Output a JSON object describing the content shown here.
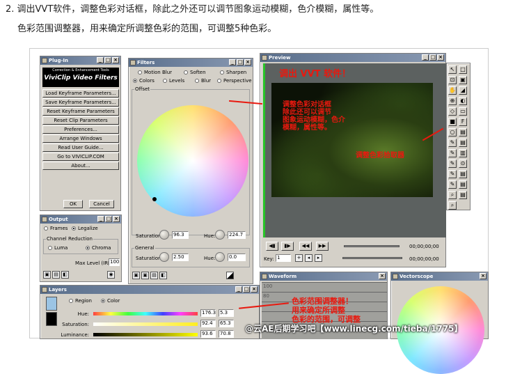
{
  "article": {
    "line1": "2. 调出VVT软件，调整色彩对话框，除此之外还可以调节图象运动模糊，色介模糊，属性等。",
    "line2": "色彩范围调整器，用来确定所调整色彩的范围，可调整5种色彩。"
  },
  "plugin": {
    "title": "Plug-In",
    "logo_top": "Correction & Enhancement Tools",
    "logo_main": "ViviClip Video Filters",
    "buttons": [
      "Load Keyframe Parameters...",
      "Save Keyframe Parameters...",
      "Reset Keyframe Parameters",
      "Reset Clip Parameters",
      "Preferences...",
      "Arrange Windows",
      "Read User Guide...",
      "Go to VIVICLIP.COM",
      "About..."
    ],
    "ok": "OK",
    "cancel": "Cancel"
  },
  "filters": {
    "title": "Filters",
    "tabs_row1": [
      "Motion Blur",
      "Soften",
      "Sharpen"
    ],
    "tabs_row2": [
      "Colors",
      "Levels",
      "Blur",
      "Perspective"
    ],
    "group_offset": "Offset",
    "saturation_label": "Saturation:",
    "saturation_value": "96.3",
    "hue_label": "Hue:",
    "hue_value": "224.7",
    "group_general": "General",
    "gen_saturation_value": "2.50",
    "gen_hue_value": "0.0"
  },
  "preview": {
    "title": "Preview",
    "timecode1": "00;00;00;00",
    "timecode2": "00;00;00;00",
    "key_label": "Key:",
    "key_value": "1"
  },
  "output": {
    "title": "Output",
    "tab_frames": "Frames",
    "tab_legalize": "Legalize",
    "group": "Channel Reduction",
    "luma": "Luma",
    "chroma": "Chroma",
    "max_level_label": "Max Level (IRE):",
    "max_level_value": "100"
  },
  "layers": {
    "title": "Layers",
    "tab_region": "Region",
    "tab_color": "Color",
    "hue_label": "Hue:",
    "hue_v1": "176.3",
    "hue_v2": "5.3",
    "sat_label": "Saturation:",
    "sat_v1": "92.4",
    "sat_v2": "65.3",
    "lum_label": "Luminance:",
    "lum_v1": "93.6",
    "lum_v2": "70.8"
  },
  "waveform": {
    "title": "Waveform",
    "scale": [
      "100",
      "80"
    ]
  },
  "vectorscope": {
    "title": "Vectorscope"
  },
  "annotations": {
    "title": "调出 VVT 软件！",
    "adjust": [
      "调整色彩对话框",
      "除此还可以调节",
      "图象运动模糊，色介",
      "模糊，属性等。"
    ],
    "picker": "调整色彩拾取器",
    "range": [
      "色彩范围调整器！",
      "用来确定所调整",
      "色彩的范围，可调整"
    ]
  },
  "watermark": "@云AE后期学习吧【www.linecg.com/tieba/1775】"
}
